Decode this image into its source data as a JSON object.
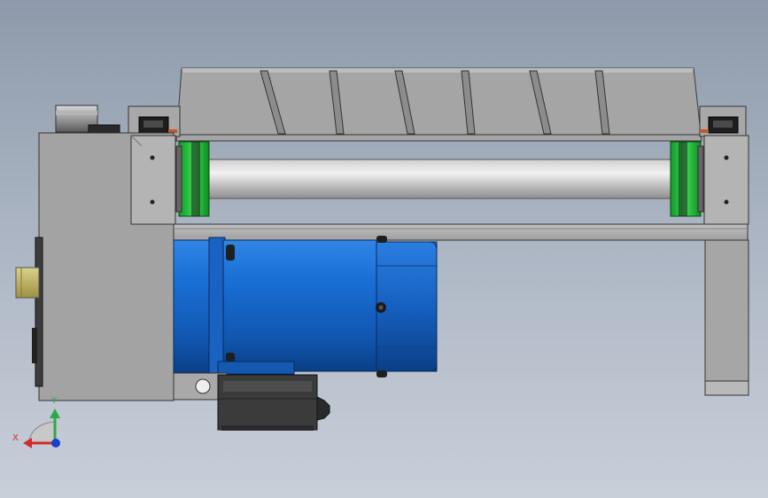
{
  "viewport": {
    "background_top": "#8e9aab",
    "background_bottom": "#c9cfd9"
  },
  "triad": {
    "x_label": "X",
    "y_label": "Y",
    "x_color": "#d22a2a",
    "y_color": "#2aa84a",
    "z_color": "#1a3fc8"
  },
  "model": {
    "motor_color": "#1764c8",
    "roller_color": "#22b53a",
    "frame_color": "#a7a7a7"
  }
}
